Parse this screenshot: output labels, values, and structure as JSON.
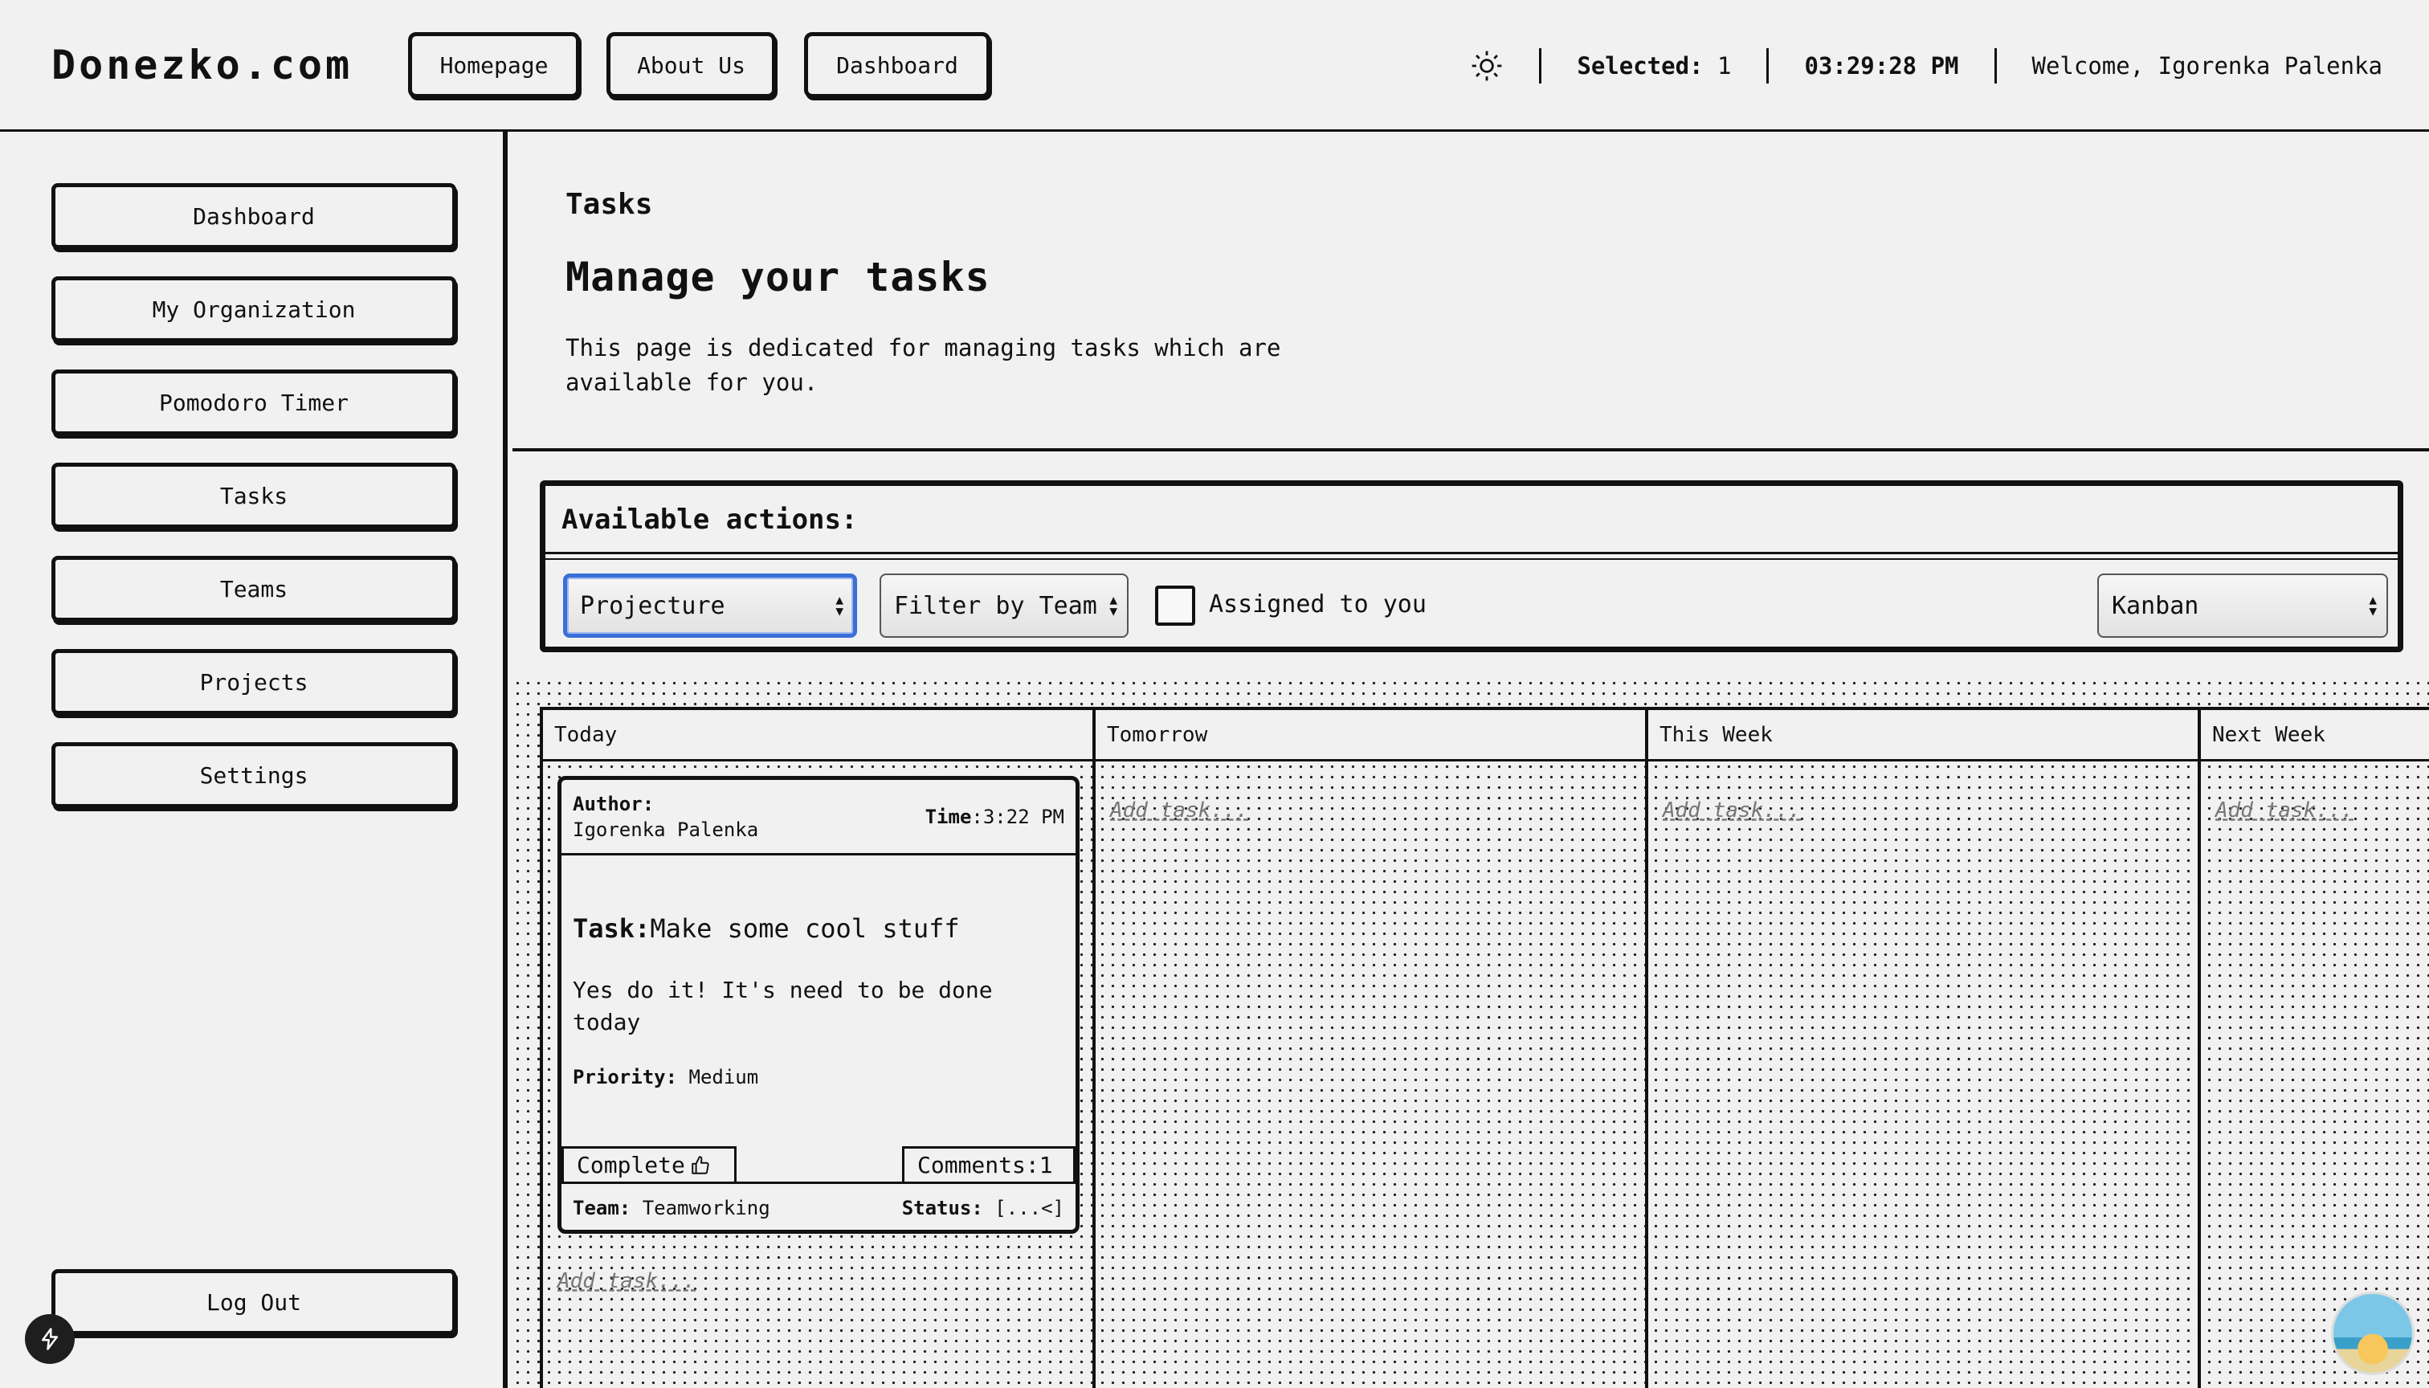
{
  "header": {
    "logo": "Donezko.com",
    "nav": [
      "Homepage",
      "About Us",
      "Dashboard"
    ],
    "selected_label": "Selected:",
    "selected_value": "1",
    "clock": "03:29:28 PM",
    "welcome": "Welcome, Igorenka Palenka"
  },
  "sidebar": {
    "items": [
      "Dashboard",
      "My Organization",
      "Pomodoro Timer",
      "Tasks",
      "Teams",
      "Projects",
      "Settings"
    ],
    "logout": "Log Out"
  },
  "intro": {
    "crumb": "Tasks",
    "title": "Manage your tasks",
    "description": "This page is dedicated for managing tasks which are available for you."
  },
  "actions": {
    "title": "Available actions:",
    "project_select": "Projecture",
    "team_select": "Filter by Team",
    "assigned_label": "Assigned to you",
    "view_select": "Kanban"
  },
  "board": {
    "columns": [
      "Today",
      "Tomorrow",
      "This Week",
      "Next Week"
    ],
    "add_task": "Add task...",
    "card": {
      "author_label": "Author:",
      "author": "Igorenka Palenka",
      "time_label": "Time",
      "time": ":3:22 PM",
      "task_label": "Task:",
      "task": "Make some cool stuff",
      "description": "Yes do it! It's need to be done today",
      "priority_label": "Priority:",
      "priority": "Medium",
      "complete_label": "Complete",
      "comments_label": "Comments:1",
      "team_label": "Team:",
      "team": "Teamworking",
      "status_label": "Status:",
      "status": "[...<]"
    }
  },
  "colors": {
    "background": "#f1f1f1",
    "ink": "#111111",
    "focus": "#3b6fd8"
  }
}
